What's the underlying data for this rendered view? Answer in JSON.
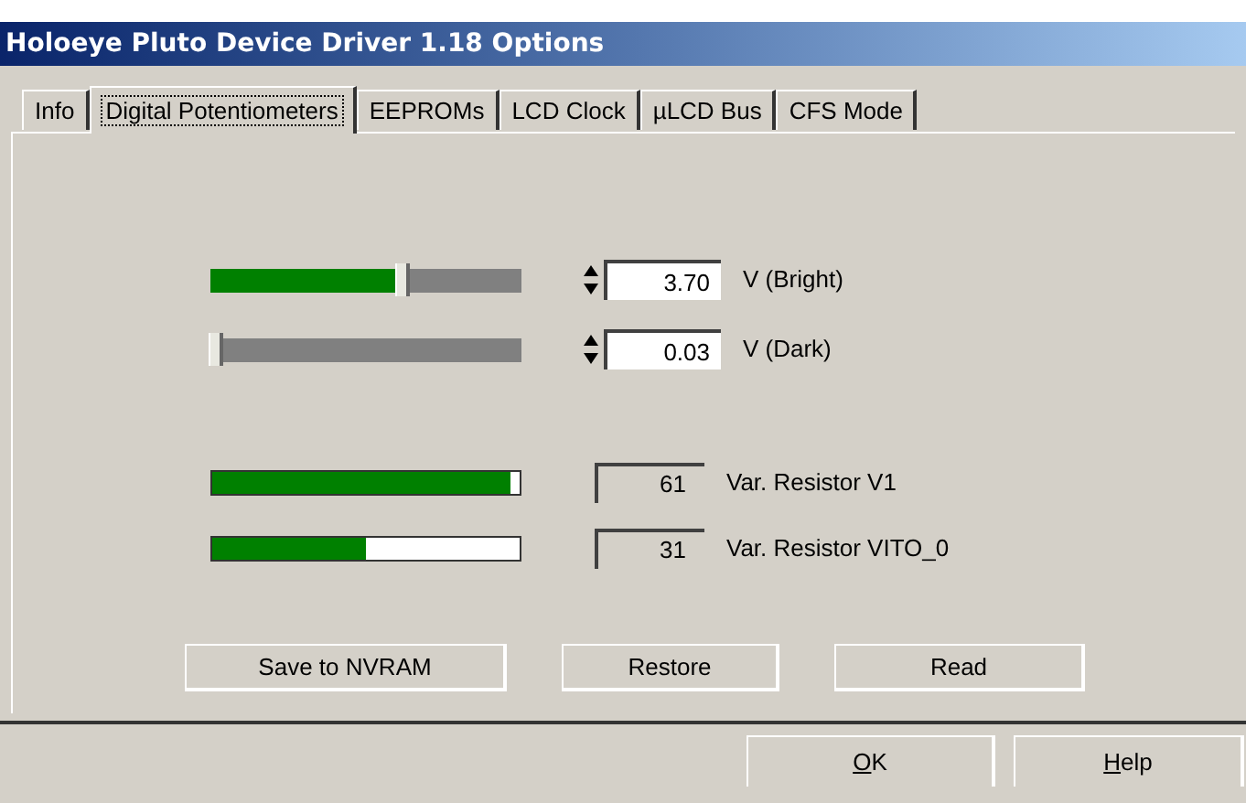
{
  "window": {
    "title": "Holoeye Pluto Device Driver 1.18 Options"
  },
  "tabs": [
    {
      "label": "Info",
      "selected": false
    },
    {
      "label": "Digital Potentiometers",
      "selected": true
    },
    {
      "label": "EEPROMs",
      "selected": false
    },
    {
      "label": "LCD Clock",
      "selected": false
    },
    {
      "label": "µLCD Bus",
      "selected": false
    },
    {
      "label": "CFS Mode",
      "selected": false
    }
  ],
  "sliders": [
    {
      "level": 0.62,
      "value": "3.70",
      "label": "V (Bright)"
    },
    {
      "level": 0.02,
      "value": "0.03",
      "label": "V (Dark)"
    }
  ],
  "meters": [
    {
      "level": 0.97,
      "reading": "61",
      "label": "Var. Resistor V1"
    },
    {
      "level": 0.5,
      "reading": "31",
      "label": "Var. Resistor VITO_0"
    }
  ],
  "buttons": [
    "Save to NVRAM",
    "Restore",
    "Read"
  ],
  "dialog_buttons": [
    "OK",
    "Help"
  ]
}
